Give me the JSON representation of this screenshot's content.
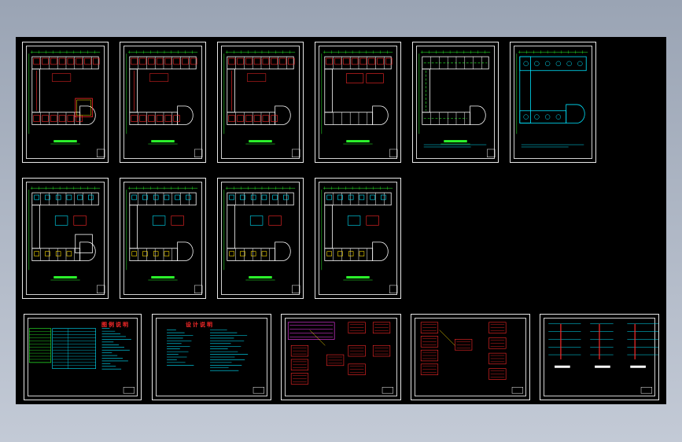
{
  "colors": {
    "background": "#000000",
    "frame": "#e8e8e8",
    "wall": "#ffffff",
    "electrical": "#ff2a2a",
    "cyan": "#00e5ff",
    "green": "#2cff2c",
    "yellow": "#ffe000",
    "magenta": "#ff40ff"
  },
  "sheets": {
    "plan_row1": [
      {
        "type": "lighting-plan"
      },
      {
        "type": "socket-plan"
      },
      {
        "type": "lighting-plan"
      },
      {
        "type": "socket-plan"
      },
      {
        "type": "grounding-plan"
      },
      {
        "type": "roof-plan"
      }
    ],
    "plan_row2": [
      {
        "type": "weak-current-plan"
      },
      {
        "type": "weak-current-plan"
      },
      {
        "type": "weak-current-plan"
      },
      {
        "type": "weak-current-plan"
      }
    ],
    "notes": [
      {
        "type": "legend-table",
        "title": "图例说明"
      },
      {
        "type": "design-notes",
        "title": "设计说明"
      }
    ],
    "schematics": [
      {
        "type": "distribution-system"
      },
      {
        "type": "distribution-system"
      },
      {
        "type": "riser-diagram"
      }
    ]
  }
}
